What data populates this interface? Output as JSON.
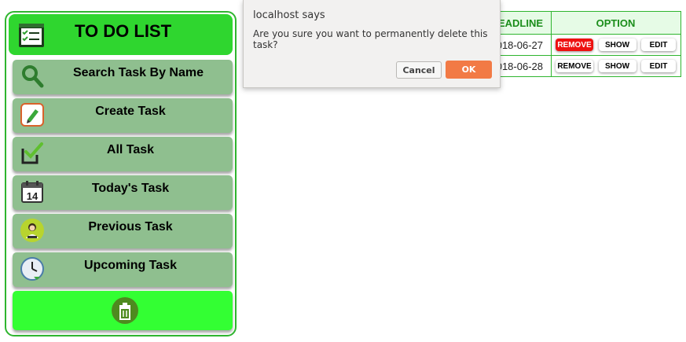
{
  "sidebar": {
    "title": "TO DO LIST",
    "menu": [
      {
        "label": "Search Task By Name",
        "icon": "search-icon"
      },
      {
        "label": "Create Task",
        "icon": "pencil-icon"
      },
      {
        "label": "All Task",
        "icon": "checkbox-icon"
      },
      {
        "label": "Today's Task",
        "icon": "calendar-icon",
        "icon_text": "14"
      },
      {
        "label": "Previous Task",
        "icon": "person-icon"
      },
      {
        "label": "Upcoming Task",
        "icon": "clock-icon"
      }
    ],
    "trash_icon": "trash-icon"
  },
  "table": {
    "headers": {
      "deadline": "EADLINE",
      "option": "OPTION"
    },
    "rows": [
      {
        "deadline": "018-06-27",
        "remove": "REMOVE",
        "show": "SHOW",
        "edit": "EDIT",
        "remove_highlighted": true
      },
      {
        "deadline": "018-06-28",
        "remove": "REMOVE",
        "show": "SHOW",
        "edit": "EDIT",
        "remove_highlighted": false
      }
    ]
  },
  "dialog": {
    "title": "localhost says",
    "message": "Are you sure you want to permanently delete this task?",
    "cancel_label": "Cancel",
    "ok_label": "OK"
  },
  "colors": {
    "header_green": "#2fd62f",
    "button_green": "#8fbf8f",
    "trash_green": "#33ff33",
    "border_green": "#2fb52f",
    "remove_red": "#ee1111",
    "ok_orange": "#f27a45"
  }
}
